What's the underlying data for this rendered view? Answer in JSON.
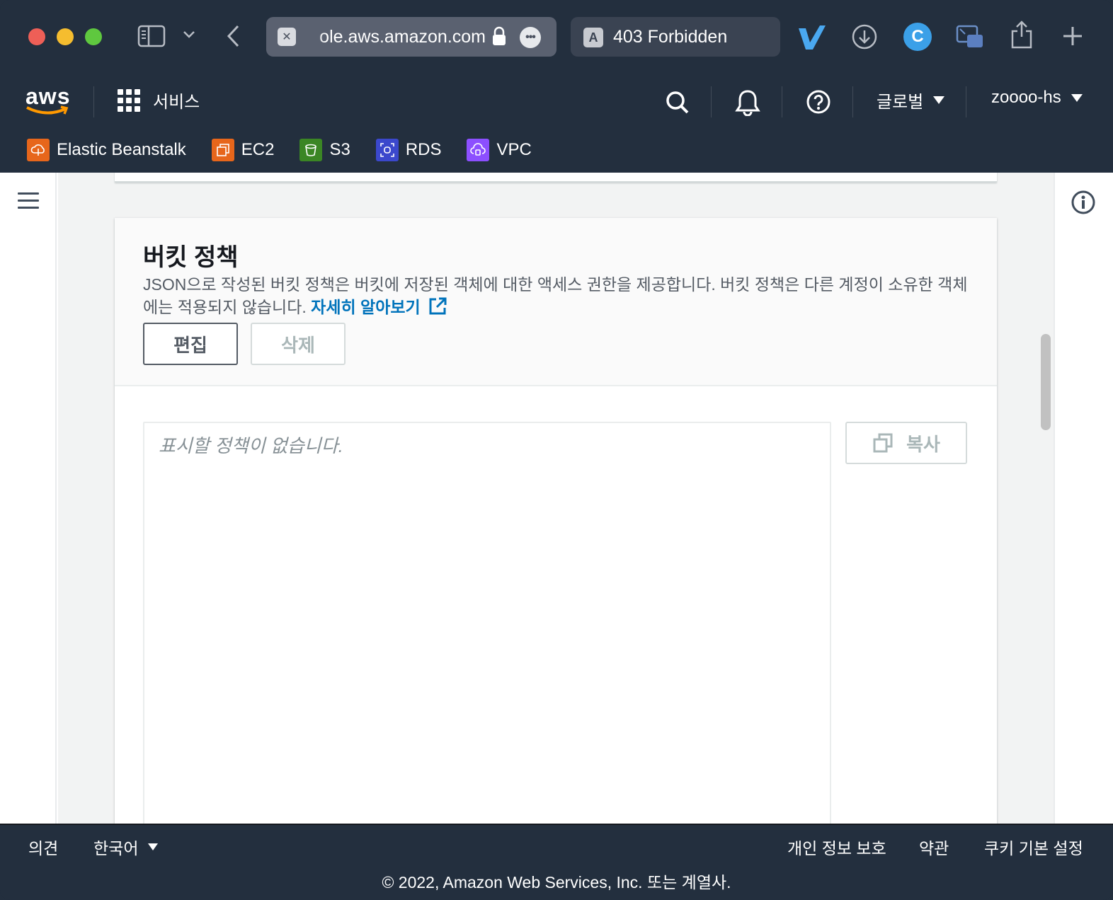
{
  "browser": {
    "url_text": "ole.aws.amazon.com",
    "tab_favicon_letter": "A",
    "tab_title": "403 Forbidden",
    "extension_c": "C"
  },
  "aws_nav": {
    "logo_text": "aws",
    "services_label": "서비스",
    "region_label": "글로벌",
    "account_label": "zoooo-hs",
    "favorites": [
      {
        "label": "Elastic Beanstalk",
        "color": "#e7661b"
      },
      {
        "label": "EC2",
        "color": "#e7661b"
      },
      {
        "label": "S3",
        "color": "#3b8624"
      },
      {
        "label": "RDS",
        "color": "#3b48cc"
      },
      {
        "label": "VPC",
        "color": "#8c4fff"
      }
    ]
  },
  "bucket_policy": {
    "title": "버킷 정책",
    "description": "JSON으로 작성된 버킷 정책은 버킷에 저장된 객체에 대한 액세스 권한을 제공합니다. 버킷 정책은 다른 계정이 소유한 객체에는 적용되지 않습니다. ",
    "learn_more": "자세히 알아보기",
    "edit_label": "편집",
    "delete_label": "삭제",
    "empty_text": "표시할 정책이 없습니다.",
    "copy_label": "복사"
  },
  "footer": {
    "feedback": "의견",
    "language": "한국어",
    "privacy": "개인 정보 보호",
    "terms": "약관",
    "cookies": "쿠키 기본 설정",
    "copyright": "© 2022, Amazon Web Services, Inc. 또는 계열사."
  },
  "colors": {
    "nav_bg": "#232f3e",
    "link_blue": "#0073bb",
    "content_bg": "#f2f3f3"
  }
}
